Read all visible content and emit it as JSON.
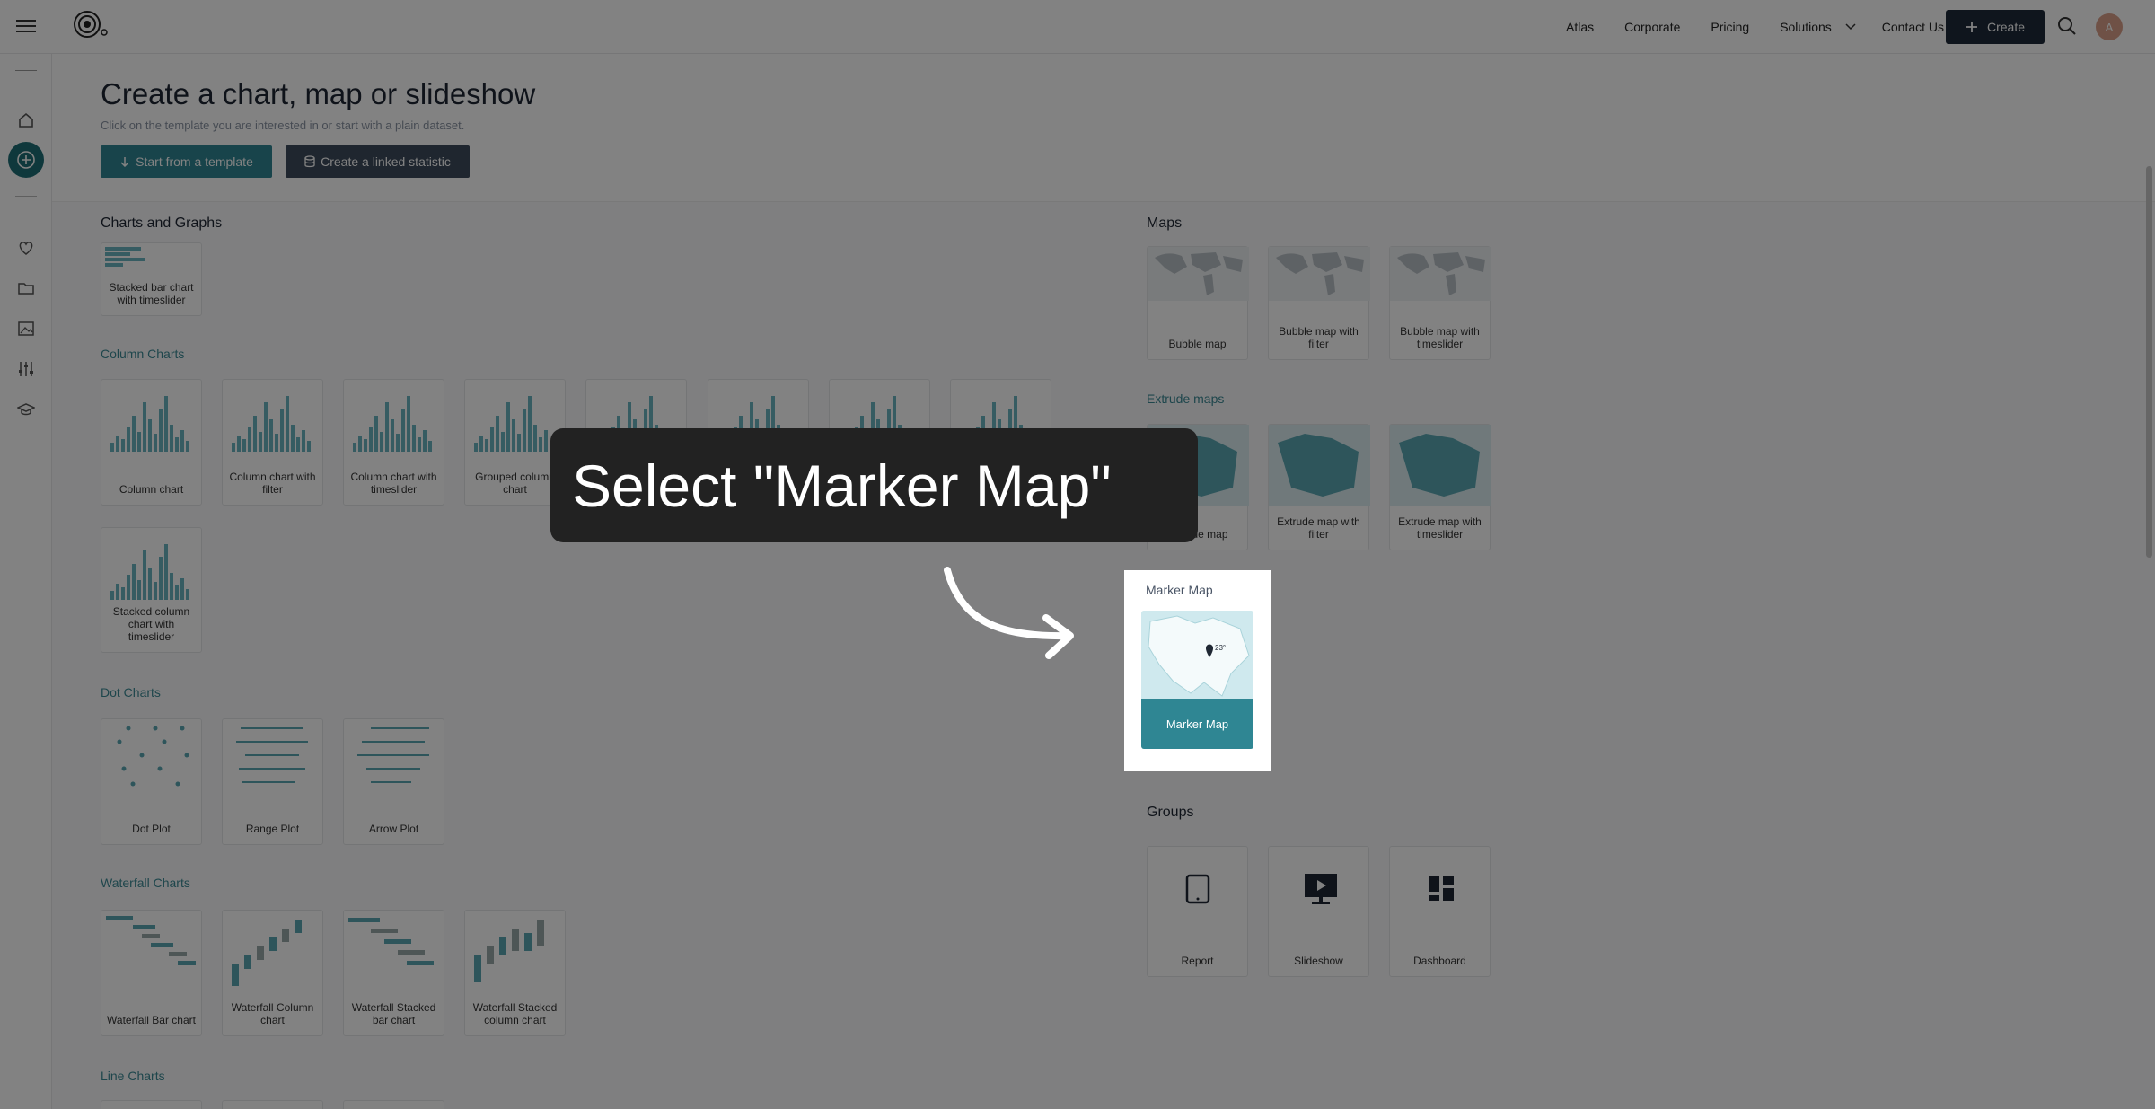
{
  "nav": {
    "items": [
      "Atlas",
      "Corporate",
      "Pricing",
      "Solutions",
      "Contact Us"
    ],
    "create_label": "Create",
    "avatar_initial": "A"
  },
  "header": {
    "title": "Create a chart, map or slideshow",
    "subtitle": "Click on the template you are interested in or start with a plain dataset.",
    "btn_template": "Start from a template",
    "btn_linked": "Create a linked statistic"
  },
  "charts": {
    "title": "Charts and Graphs",
    "bar_item": "Stacked bar chart with timeslider",
    "column_title": "Column Charts",
    "column_items": [
      "Column chart",
      "Column chart with filter",
      "Column chart with timeslider",
      "Grouped column chart"
    ],
    "stacked_column": "Stacked column chart with timeslider",
    "dot_title": "Dot Charts",
    "dot_items": [
      "Dot Plot",
      "Range Plot",
      "Arrow Plot"
    ],
    "waterfall_title": "Waterfall Charts",
    "waterfall_items": [
      "Waterfall Bar chart",
      "Waterfall Column chart",
      "Waterfall Stacked bar chart",
      "Waterfall Stacked column chart"
    ],
    "line_title": "Line Charts"
  },
  "maps": {
    "title": "Maps",
    "bubble_items": [
      "Bubble map",
      "Bubble map with filter",
      "Bubble map with timeslider"
    ],
    "extrude_title": "Extrude maps",
    "extrude_items": [
      "Extrude map",
      "Extrude map with filter",
      "Extrude map with timeslider"
    ],
    "marker_title": "Marker Map",
    "marker_item": "Marker Map",
    "marker_pin": "23°"
  },
  "groups": {
    "title": "Groups",
    "items": [
      "Report",
      "Slideshow",
      "Dashboard"
    ]
  },
  "callout": "Select \"Marker Map\"",
  "colors": {
    "accent": "#2f8693",
    "dark": "#1e2a3a",
    "overlay": "rgba(0,0,0,0.49)"
  }
}
